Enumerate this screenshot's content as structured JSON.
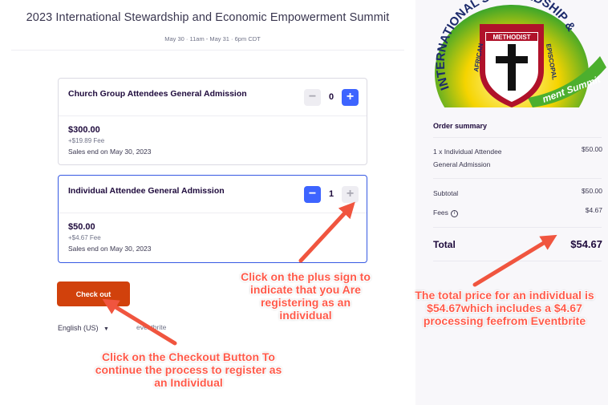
{
  "event": {
    "title": "2023 International Stewardship and Economic Empowerment Summit",
    "date_range": "May 30 · 11am - May 31 · 6pm CDT"
  },
  "tickets": [
    {
      "name": "Church Group Attendees General Admission",
      "quantity": "0",
      "price": "$300.00",
      "fee": "+$19.89 Fee",
      "sales_end": "Sales end on May 30, 2023"
    },
    {
      "name": "Individual Attendee General Admission",
      "quantity": "1",
      "price": "$50.00",
      "fee": "+$4.67 Fee",
      "sales_end": "Sales end on May 30, 2023"
    }
  ],
  "stepper": {
    "minus": "−",
    "plus": "+"
  },
  "checkout_label": "Check out",
  "language": "English (US)",
  "brand": "eventbrite",
  "logo": {
    "ring_text": "INTERNATIONAL STEWARDSHIP &",
    "shield_top": "METHODIST",
    "shield_left": "AFRICAN",
    "shield_right": "EPISCOPAL",
    "ribbon": "ment Summit"
  },
  "order_summary": {
    "heading": "Order summary",
    "line_item_label": "1 x Individual Attendee General Admission",
    "line_item_value": "$50.00",
    "subtotal_label": "Subtotal",
    "subtotal_value": "$50.00",
    "fees_label": "Fees",
    "fees_value": "$4.67",
    "total_label": "Total",
    "total_value": "$54.67"
  },
  "annotations": {
    "plus_note": "Click on the plus sign to indicate that you Are registering as an individual",
    "checkout_note": "Click on the Checkout Button To continue the process to register as an Individual",
    "total_note": "The total price for an individual is $54.67which includes a $4.67 processing feefrom Eventbrite"
  },
  "colors": {
    "accent_blue": "#3d64ff",
    "checkout_orange": "#d1410c",
    "annotation_red": "#ff5a4a"
  }
}
